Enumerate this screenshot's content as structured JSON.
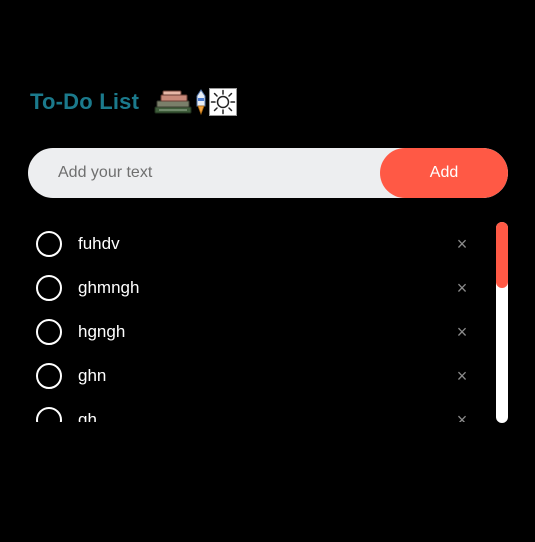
{
  "header": {
    "title": "To-Do List",
    "icons": [
      "books-icon",
      "rocket-pencil-icon",
      "sun-icon"
    ]
  },
  "input": {
    "placeholder": "Add your text",
    "value": ""
  },
  "add_button": {
    "label": "Add",
    "color": "#ff5945"
  },
  "tasks": [
    {
      "text": "fuhdv",
      "done": false,
      "delete_label": "×"
    },
    {
      "text": "ghmngh",
      "done": false,
      "delete_label": "×"
    },
    {
      "text": "hgngh",
      "done": false,
      "delete_label": "×"
    },
    {
      "text": "ghn",
      "done": false,
      "delete_label": "×"
    },
    {
      "text": "gh",
      "done": false,
      "delete_label": "×"
    }
  ],
  "colors": {
    "title": "#1b7a8c",
    "accent": "#ff5945",
    "background": "#000000"
  }
}
